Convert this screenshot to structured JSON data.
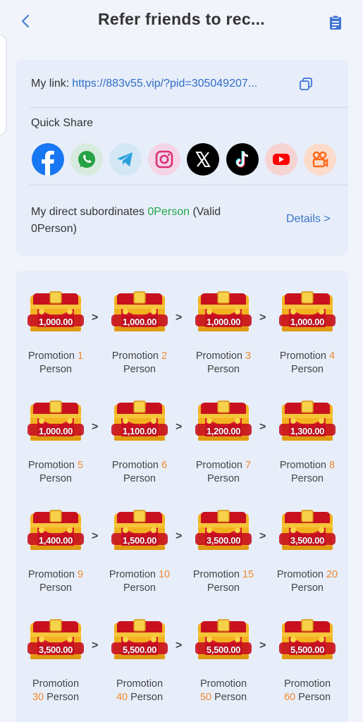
{
  "header": {
    "title": "Refer friends to rec..."
  },
  "link": {
    "label": "My link:",
    "url": "https://883v55.vip/?pid=305049207..."
  },
  "quick_share": {
    "label": "Quick Share",
    "icons": [
      "facebook-icon",
      "whatsapp-icon",
      "telegram-icon",
      "instagram-icon",
      "x-icon",
      "tiktok-icon",
      "youtube-icon",
      "kwai-icon"
    ]
  },
  "subordinates": {
    "prefix": "My direct subordinates ",
    "count": "0Person",
    "suffix": " (Valid 0Person)",
    "details": "Details >"
  },
  "rewards": [
    {
      "amount": "1,000.00",
      "word": "Promotion",
      "num": "1",
      "unit": "Person"
    },
    {
      "amount": "1,000.00",
      "word": "Promotion",
      "num": "2",
      "unit": "Person"
    },
    {
      "amount": "1,000.00",
      "word": "Promotion",
      "num": "3",
      "unit": "Person"
    },
    {
      "amount": "1,000.00",
      "word": "Promotion",
      "num": "4",
      "unit": "Person"
    },
    {
      "amount": "1,000.00",
      "word": "Promotion",
      "num": "5",
      "unit": "Person"
    },
    {
      "amount": "1,100.00",
      "word": "Promotion",
      "num": "6",
      "unit": "Person"
    },
    {
      "amount": "1,200.00",
      "word": "Promotion",
      "num": "7",
      "unit": "Person"
    },
    {
      "amount": "1,300.00",
      "word": "Promotion",
      "num": "8",
      "unit": "Person"
    },
    {
      "amount": "1,400.00",
      "word": "Promotion",
      "num": "9",
      "unit": "Person"
    },
    {
      "amount": "1,500.00",
      "word": "Promotion",
      "num": "10",
      "unit": "Person"
    },
    {
      "amount": "3,500.00",
      "word": "Promotion",
      "num": "15",
      "unit": "Person"
    },
    {
      "amount": "3,500.00",
      "word": "Promotion",
      "num": "20",
      "unit": "Person"
    },
    {
      "amount": "3,500.00",
      "word": "Promotion",
      "num": "30",
      "unit": "Person"
    },
    {
      "amount": "5,500.00",
      "word": "Promotion",
      "num": "40",
      "unit": "Person"
    },
    {
      "amount": "5,500.00",
      "word": "Promotion",
      "num": "50",
      "unit": "Person"
    },
    {
      "amount": "5,500.00",
      "word": "Promotion",
      "num": "60",
      "unit": "Person"
    }
  ],
  "arrow": ">"
}
